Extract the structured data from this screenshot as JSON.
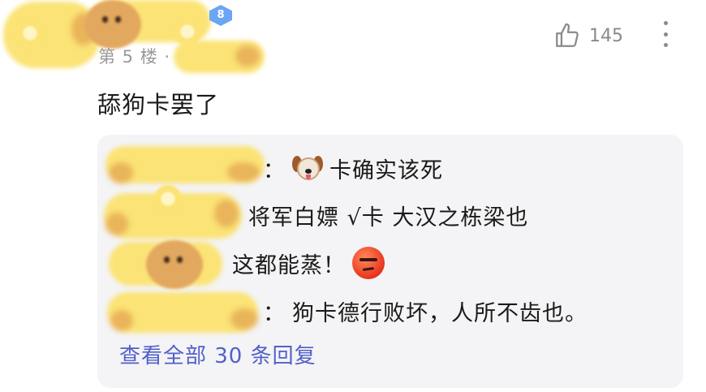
{
  "post": {
    "level": "8",
    "floor": "第 5 楼 ·",
    "like_count": "145",
    "content": "舔狗卡罢了"
  },
  "replies": [
    {
      "colon": "：",
      "emoji": "dog-face",
      "text": "卡确实该死"
    },
    {
      "text": "将军白嫖 √卡 大汉之栋梁也"
    },
    {
      "text": "这都能蒸！",
      "emoji": "smirking-face"
    },
    {
      "colon": "：",
      "text": "狗卡德行败坏，人所不齿也。"
    }
  ],
  "view_all": "查看全部 30 条回复",
  "colors": {
    "link": "#5160c9",
    "muted": "#9a9a9a",
    "reply_bg": "#f4f4f6",
    "badge": "#6ba6f4",
    "sticker": "#fbe375"
  },
  "icons": [
    "thumb-up-icon",
    "more-vertical-icon",
    "dog-face-emoji",
    "smirking-face-emoji",
    "level-badge-icon"
  ]
}
